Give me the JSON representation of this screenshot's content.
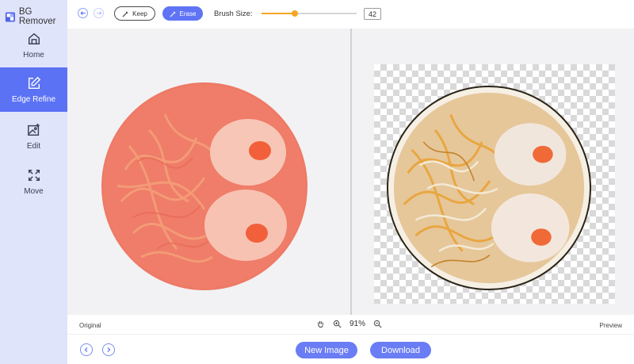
{
  "app": {
    "title": "BG Remover",
    "logo_icon": "bg-remover-logo-icon"
  },
  "sidebar": {
    "items": [
      {
        "label": "Home",
        "icon": "home-icon",
        "active": false
      },
      {
        "label": "Edge Refine",
        "icon": "edit-square-icon",
        "active": true
      },
      {
        "label": "Edit",
        "icon": "image-edit-icon",
        "active": false
      },
      {
        "label": "Move",
        "icon": "move-arrows-icon",
        "active": false
      }
    ]
  },
  "toolbar": {
    "undo_icon": "undo-icon",
    "redo_icon": "redo-icon",
    "keep_label": "Keep",
    "erase_label": "Erase",
    "brush_label": "Brush Size:",
    "brush_value": "42",
    "brush_slider_fraction": 0.35,
    "accent_color": "#5f74f5",
    "slider_color": "#f5a623"
  },
  "status": {
    "original_label": "Original",
    "preview_label": "Preview",
    "zoom_value": "91%",
    "hand_icon": "hand-pan-icon",
    "zoom_in_icon": "zoom-in-icon",
    "zoom_out_icon": "zoom-out-icon"
  },
  "bottom": {
    "prev_icon": "chevron-left-icon",
    "next_icon": "chevron-right-icon",
    "new_image_label": "New Image",
    "download_label": "Download",
    "button_color": "#6a7df5"
  }
}
